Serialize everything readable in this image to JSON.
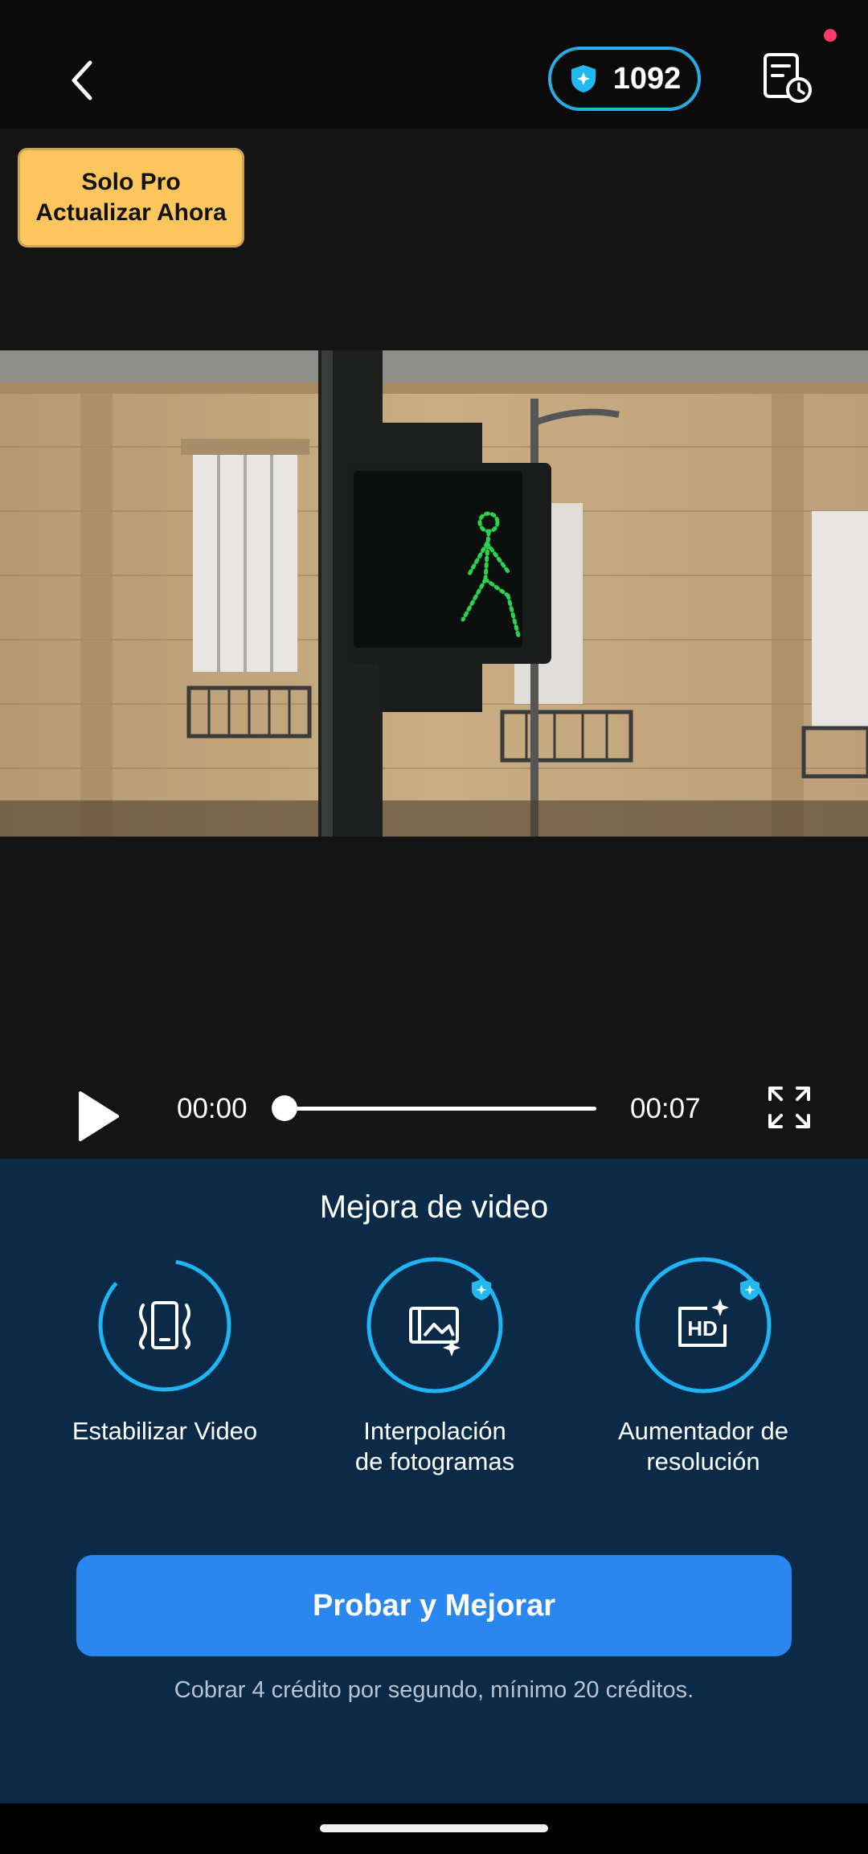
{
  "header": {
    "credits": "1092"
  },
  "pro_badge": {
    "line1": "Solo Pro",
    "line2": "Actualizar Ahora"
  },
  "player": {
    "current_time": "00:00",
    "duration": "00:07",
    "progress": 0
  },
  "panel": {
    "title": "Mejora de video",
    "features": [
      {
        "label_line1": "Estabilizar Video",
        "label_line2": "",
        "icon": "stabilize-icon",
        "pro": false
      },
      {
        "label_line1": "Interpolación",
        "label_line2": "de fotogramas",
        "icon": "frame-interpolation-icon",
        "pro": true
      },
      {
        "label_line1": "Aumentador de",
        "label_line2": "resolución",
        "icon": "hd-upscale-icon",
        "pro": true
      }
    ],
    "cta_label": "Probar y Mejorar",
    "note": "Cobrar 4 crédito por segundo, mínimo 20 créditos."
  },
  "colors": {
    "accent": "#2a87f0",
    "panel_bg": "#0b2a48",
    "pro_badge": "#fdc65c",
    "notification": "#ff3b6b"
  }
}
